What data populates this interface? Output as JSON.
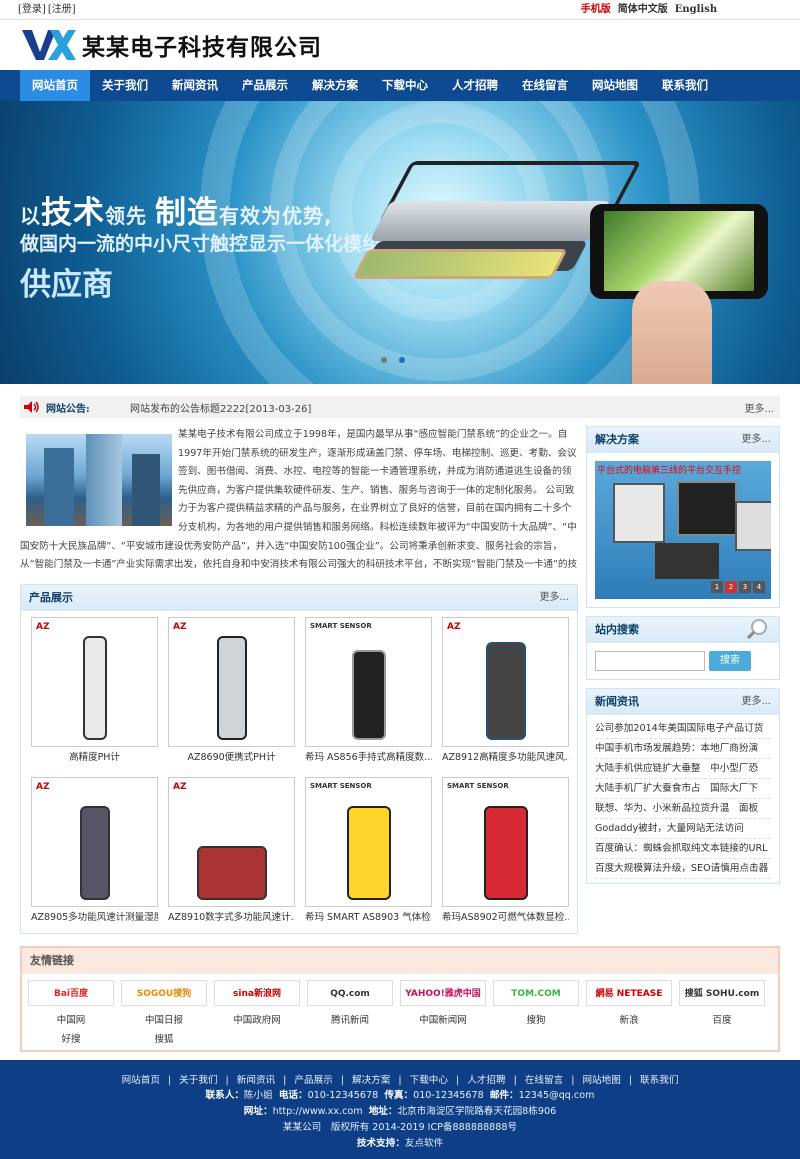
{
  "topbar": {
    "login": "[登录]",
    "register": "[注册]",
    "mobile": "手机版",
    "lang_cn": "简体中文版",
    "lang_en": "English"
  },
  "header": {
    "company": "某某电子科技有限公司"
  },
  "nav": [
    "网站首页",
    "关于我们",
    "新闻资讯",
    "产品展示",
    "解决方案",
    "下载中心",
    "人才招聘",
    "在线留言",
    "网站地图",
    "联系我们"
  ],
  "banner": {
    "line1_a": "以",
    "line1_b": "技术",
    "line1_c": "领先",
    "line1_d": "制造",
    "line1_e": "有效为优势,",
    "line2": "做国内一流的中小尺寸触控显示一体化模组",
    "line3": "供应商"
  },
  "notice": {
    "title": "网站公告:",
    "message": "网站发布的公告标题2222[2013-03-26]",
    "more": "更多..."
  },
  "about": {
    "text": "某某电子技术有限公司成立于1998年，是国内最早从事“感应智能门禁系统”的企业之一。自1997年开始门禁系统的研发生产，逐渐形成涵盖门禁、停车场、电梯控制、巡更、考勤、会议签到、图书借阅、消费、水控、电控等的智能一卡通管理系统，并成为消防通道逃生设备的领先供应商，为客户提供集软硬件研发、生产、销售、服务与咨询于一体的定制化服务。 公司致力于为客户提供精益求精的产品与服务，在业界树立了良好的信誉，目前在国内拥有二十多个分支机构，为各地的用户提供销售和服务网络。科松连续数年被评为“中国安防十大品牌”、“中国安防十大民族品牌”、“平安城市建设优秀安防产品”，并入选“中国安防100强企业”。公司将秉承创新求变、服务社会的宗旨，从“智能门禁及一卡通”产业实际需求出发，依托自身和中安消技术有限公司强大的科研技术平台，不断实现“智能门禁及一卡通”的技术突破，引领和推动"
  },
  "products": {
    "title": "产品展示",
    "more": "更多...",
    "items": [
      {
        "name": "高精度PH计",
        "brand": "AZ"
      },
      {
        "name": "AZ8690便携式PH计",
        "brand": "AZ"
      },
      {
        "name": "希玛 AS856手持式高精度数…",
        "brand": "SMART SENSOR"
      },
      {
        "name": "AZ8912高精度多功能风速风…",
        "brand": "AZ"
      },
      {
        "name": "AZ8905多功能风速计测量湿度",
        "brand": "AZ"
      },
      {
        "name": "AZ8910数字式多功能风速计…",
        "brand": "AZ"
      },
      {
        "name": "希玛 SMART AS8903 气体检…",
        "brand": "SMART SENSOR"
      },
      {
        "name": "希玛AS8902可燃气体数显检…",
        "brand": "SMART SENSOR"
      }
    ]
  },
  "solutions": {
    "title": "解决方案",
    "more": "更多...",
    "caption": "平台式的电脑第三线的平台交互手控",
    "pager": [
      "1",
      "2",
      "3",
      "4"
    ]
  },
  "search": {
    "title": "站内搜索",
    "button": "搜索",
    "placeholder": ""
  },
  "news": {
    "title": "新闻资讯",
    "more": "更多...",
    "items": [
      "公司参加2014年美国国际电子产品订货",
      "中国手机市场发展趋势：本地厂商扮演",
      "大陆手机供应链扩大垂整　中小型厂恐",
      "大陆手机厂扩大蚕食市占　国际大厂下",
      "联想、华为、小米新品拉货升温　面板",
      "Godaddy被封，大量网站无法访问",
      "百度确认：蜘蛛会抓取纯文本链接的URL",
      "百度大规模算法升级，SEO请慎用点击器"
    ]
  },
  "links": {
    "title": "友情链接",
    "items": [
      {
        "logo": "Bai百度",
        "label": "中国网"
      },
      {
        "logo": "SOGOU搜狗",
        "label": "中国日报"
      },
      {
        "logo": "sina新浪网",
        "label": "中国政府网"
      },
      {
        "logo": "QQ.com",
        "label": "腾讯新闻"
      },
      {
        "logo": "YAHOO!雅虎中国",
        "label": "中国新闻网"
      },
      {
        "logo": "TOM.COM",
        "label": "搜狗"
      },
      {
        "logo": "網易 NETEASE",
        "label": "新浪"
      },
      {
        "logo": "搜狐 SOHU.com",
        "label": "百度"
      }
    ],
    "extra": [
      "好搜",
      "搜狐"
    ]
  },
  "footer": {
    "nav": [
      "网站首页",
      "关于我们",
      "新闻资讯",
      "产品展示",
      "解决方案",
      "下载中心",
      "人才招聘",
      "在线留言",
      "网站地图",
      "联系我们"
    ],
    "contact_label": "联系人：",
    "contact": "陈小姐",
    "phone_label": "电话：",
    "phone": "010-12345678",
    "fax_label": "传真：",
    "fax": "010-12345678",
    "mail_label": "邮件：",
    "mail": "12345@qq.com",
    "web_label": "网址：",
    "web": "http://www.xx.com",
    "addr_label": "地址：",
    "addr": "北京市海淀区学院路春天花园8栋906",
    "copyright": "某某公司　版权所有 2014-2019 ICP备888888888号",
    "tech_label": "技术支持：",
    "tech": "友点软件"
  },
  "colors": {
    "nav": "#0e4a92",
    "nav_active": "#2a8ce2",
    "footer": "#0e3f86",
    "accent_red": "#cc0000"
  }
}
